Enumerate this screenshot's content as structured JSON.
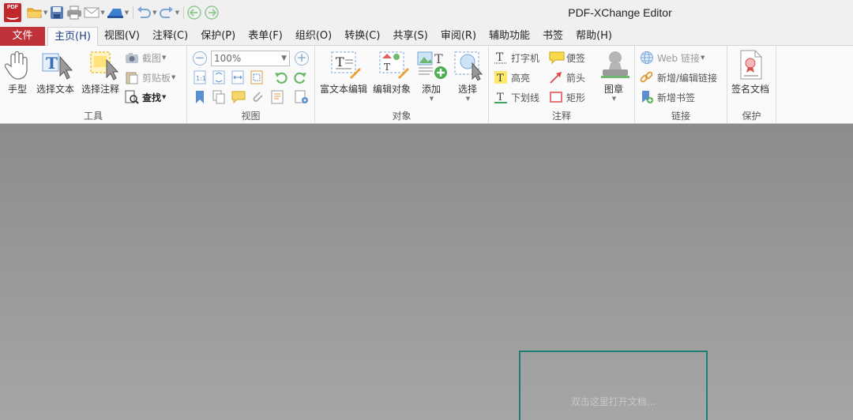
{
  "app": {
    "title": "PDF-XChange Editor",
    "logo_text": "PDF"
  },
  "quick_access": {
    "items": [
      "open-folder-icon",
      "save-icon",
      "print-icon",
      "email-icon",
      "scan-icon",
      "undo-icon",
      "redo-icon",
      "back-icon",
      "forward-icon"
    ]
  },
  "menu": {
    "file_label": "文件",
    "tabs": [
      {
        "label": "主页(H)",
        "active": true
      },
      {
        "label": "视图(V)"
      },
      {
        "label": "注释(C)"
      },
      {
        "label": "保护(P)"
      },
      {
        "label": "表单(F)"
      },
      {
        "label": "组织(O)"
      },
      {
        "label": "转换(C)"
      },
      {
        "label": "共享(S)"
      },
      {
        "label": "审阅(R)"
      },
      {
        "label": "辅助功能"
      },
      {
        "label": "书签"
      },
      {
        "label": "帮助(H)"
      }
    ]
  },
  "ribbon": {
    "tools": {
      "label": "工具",
      "hand": "手型",
      "select_text": "选择文本",
      "select_annotation": "选择注释",
      "snapshot": "截图",
      "clipboard": "剪贴板",
      "find": "查找"
    },
    "view": {
      "label": "视图",
      "zoom": "100%"
    },
    "objects": {
      "label": "对象",
      "rich_text_edit": "富文本编辑",
      "edit_object": "编辑对象",
      "add": "添加",
      "select": "选择"
    },
    "comments": {
      "label": "注释",
      "typewriter": "打字机",
      "sticky_note": "便签",
      "highlight": "高亮",
      "arrow": "箭头",
      "underline": "下划线",
      "rectangle": "矩形",
      "stamp": "图章"
    },
    "links": {
      "label": "链接",
      "web_links": "Web 链接",
      "add_edit_link": "新增/编辑链接",
      "add_bookmark": "新增书签"
    },
    "protect": {
      "label": "保护",
      "sign_document": "签名文档"
    }
  },
  "workspace": {
    "open_hint": "双击这里打开文档..."
  },
  "colors": {
    "accent_red": "#c0323a",
    "active_tab_text": "#1a3f8a",
    "drop_box_border": "#1f7f74"
  }
}
